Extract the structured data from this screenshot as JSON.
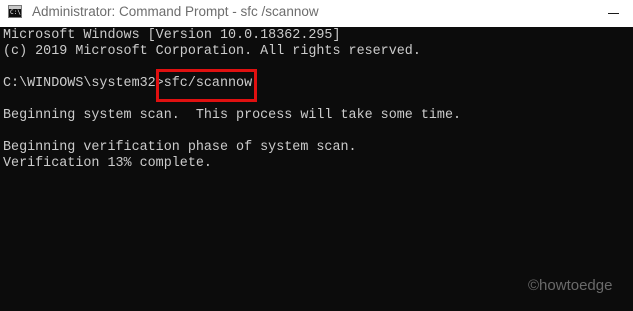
{
  "window": {
    "title": "Administrator: Command Prompt - sfc /scannow",
    "icon": "cmd-icon",
    "icon_text": "C:\\"
  },
  "console": {
    "lines": [
      "Microsoft Windows [Version 10.0.18362.295]",
      "(c) 2019 Microsoft Corporation. All rights reserved.",
      "Beginning system scan.  This process will take some time.",
      "Beginning verification phase of system scan.",
      "Verification 13% complete."
    ],
    "prompt": "C:\\WINDOWS\\system32>",
    "command": "sfc/scannow"
  },
  "watermark": "©howtoedge",
  "colors": {
    "background": "#0c0c0c",
    "text": "#cccccc",
    "highlight": "#e01010",
    "titlebar": "#ffffff"
  }
}
